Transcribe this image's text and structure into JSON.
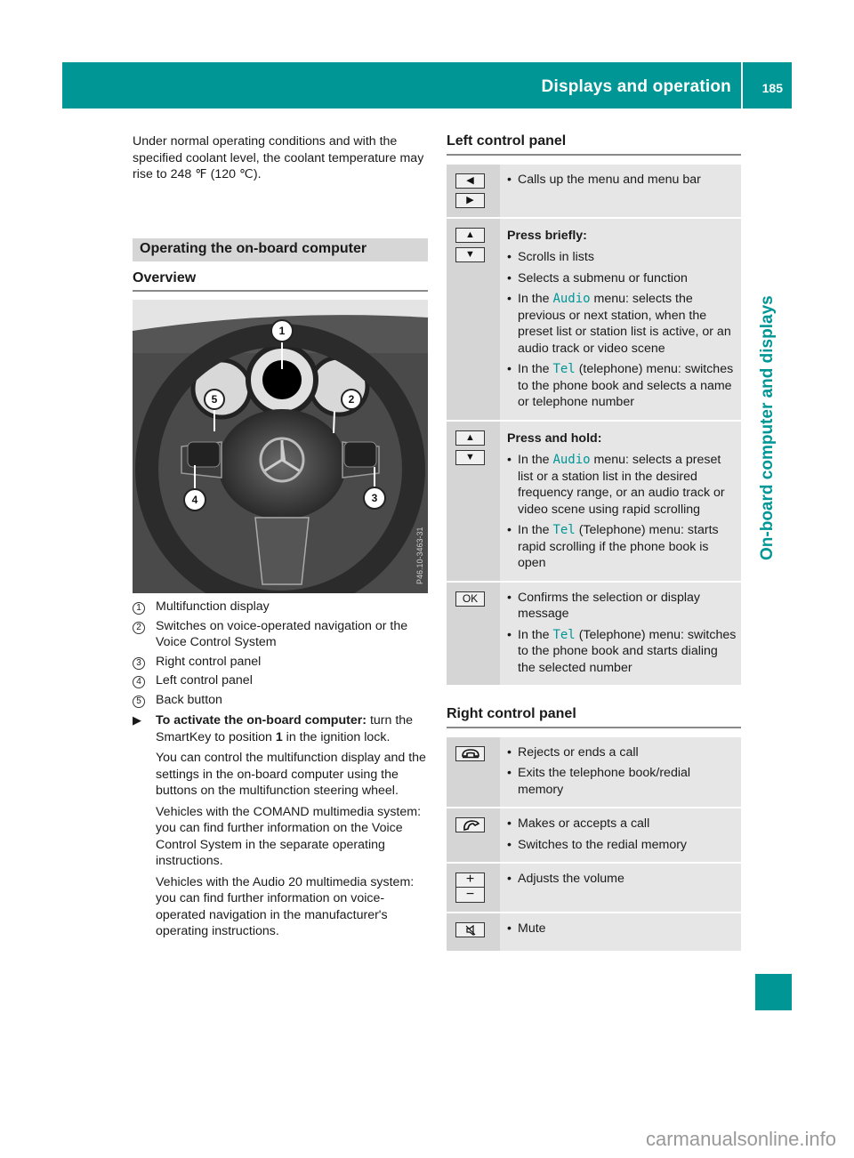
{
  "header": {
    "title": "Displays and operation",
    "page_number": "185",
    "side_label": "On-board computer and displays",
    "accent_color": "#009696"
  },
  "left": {
    "intro": "Under normal operating conditions and with the specified coolant level, the coolant temperature may rise to 248 ℉ (120 ℃).",
    "section_title": "Operating the on-board computer",
    "overview_title": "Overview",
    "photo": {
      "description": "Steering wheel with multifunction buttons and instrument cluster",
      "callouts": [
        "1",
        "2",
        "3",
        "4",
        "5"
      ],
      "image_code": "P46.10-3463-31"
    },
    "legend": [
      {
        "num": "1",
        "text": "Multifunction display"
      },
      {
        "num": "2",
        "text": "Switches on voice-operated navigation or the Voice Control System"
      },
      {
        "num": "3",
        "text": "Right control panel"
      },
      {
        "num": "4",
        "text": "Left control panel"
      },
      {
        "num": "5",
        "text": "Back button"
      }
    ],
    "instruction": {
      "arrow": "▶",
      "lead": "To activate the on-board computer:",
      "text_a": " turn the SmartKey to position ",
      "position": "1",
      "text_b": " in the ignition lock.",
      "p1": "You can control the multifunction display and the settings in the on-board computer using the buttons on the multifunction steering wheel.",
      "p2": "Vehicles with the COMAND multimedia system: you can find further information on the Voice Control System in the separate operating instructions.",
      "p3": "Vehicles with the Audio 20 multimedia system: you can find further information on voice-operated navigation in the manufacturer's operating instructions."
    }
  },
  "right": {
    "left_panel_title": "Left control panel",
    "left_panel": [
      {
        "keys": [
          "◀",
          "▶"
        ],
        "key_icons": [
          "left-arrow-button-icon",
          "right-arrow-button-icon"
        ],
        "items": [
          "Calls up the menu and menu bar"
        ]
      },
      {
        "keys": [
          "▲",
          "▼"
        ],
        "key_icons": [
          "up-arrow-button-icon",
          "down-arrow-button-icon"
        ],
        "lead": "Press briefly:",
        "items": [
          "Scrolls in lists",
          "Selects a submenu or function"
        ],
        "audio_item": {
          "pre": "In the ",
          "code": "Audio",
          "post": " menu: selects the previous or next station, when the preset list or station list is active, or an audio track or video scene"
        },
        "tel_item": {
          "pre": "In the ",
          "code": "Tel",
          "post": " (telephone) menu: switches to the phone book and selects a name or telephone number"
        }
      },
      {
        "keys": [
          "▲",
          "▼"
        ],
        "key_icons": [
          "up-arrow-button-icon",
          "down-arrow-button-icon"
        ],
        "lead": "Press and hold:",
        "audio_item": {
          "pre": "In the ",
          "code": "Audio",
          "post": " menu: selects a preset list or a station list in the desired frequency range, or an audio track or video scene using rapid scrolling"
        },
        "tel_item": {
          "pre": "In the ",
          "code": "Tel",
          "post": " (Telephone) menu: starts rapid scrolling if the phone book is open"
        }
      },
      {
        "keys": [
          "OK"
        ],
        "key_icons": [
          "ok-button-icon"
        ],
        "items": [
          "Confirms the selection or display message"
        ],
        "tel_item": {
          "pre": "In the ",
          "code": "Tel",
          "post": " (Telephone) menu: switches to the phone book and starts dialing the selected number"
        }
      }
    ],
    "right_panel_title": "Right control panel",
    "right_panel": [
      {
        "key_icon": "end-call-icon",
        "items": [
          "Rejects or ends a call",
          "Exits the telephone book/redial memory"
        ]
      },
      {
        "key_icon": "accept-call-icon",
        "items": [
          "Makes or accepts a call",
          "Switches to the redial memory"
        ]
      },
      {
        "keys": [
          "+",
          "−"
        ],
        "key_icons": [
          "volume-up-icon",
          "volume-down-icon"
        ],
        "items": [
          "Adjusts the volume"
        ]
      },
      {
        "key_icon": "mute-icon",
        "items": [
          "Mute"
        ]
      }
    ]
  },
  "watermark": "carmanualsonline.info"
}
